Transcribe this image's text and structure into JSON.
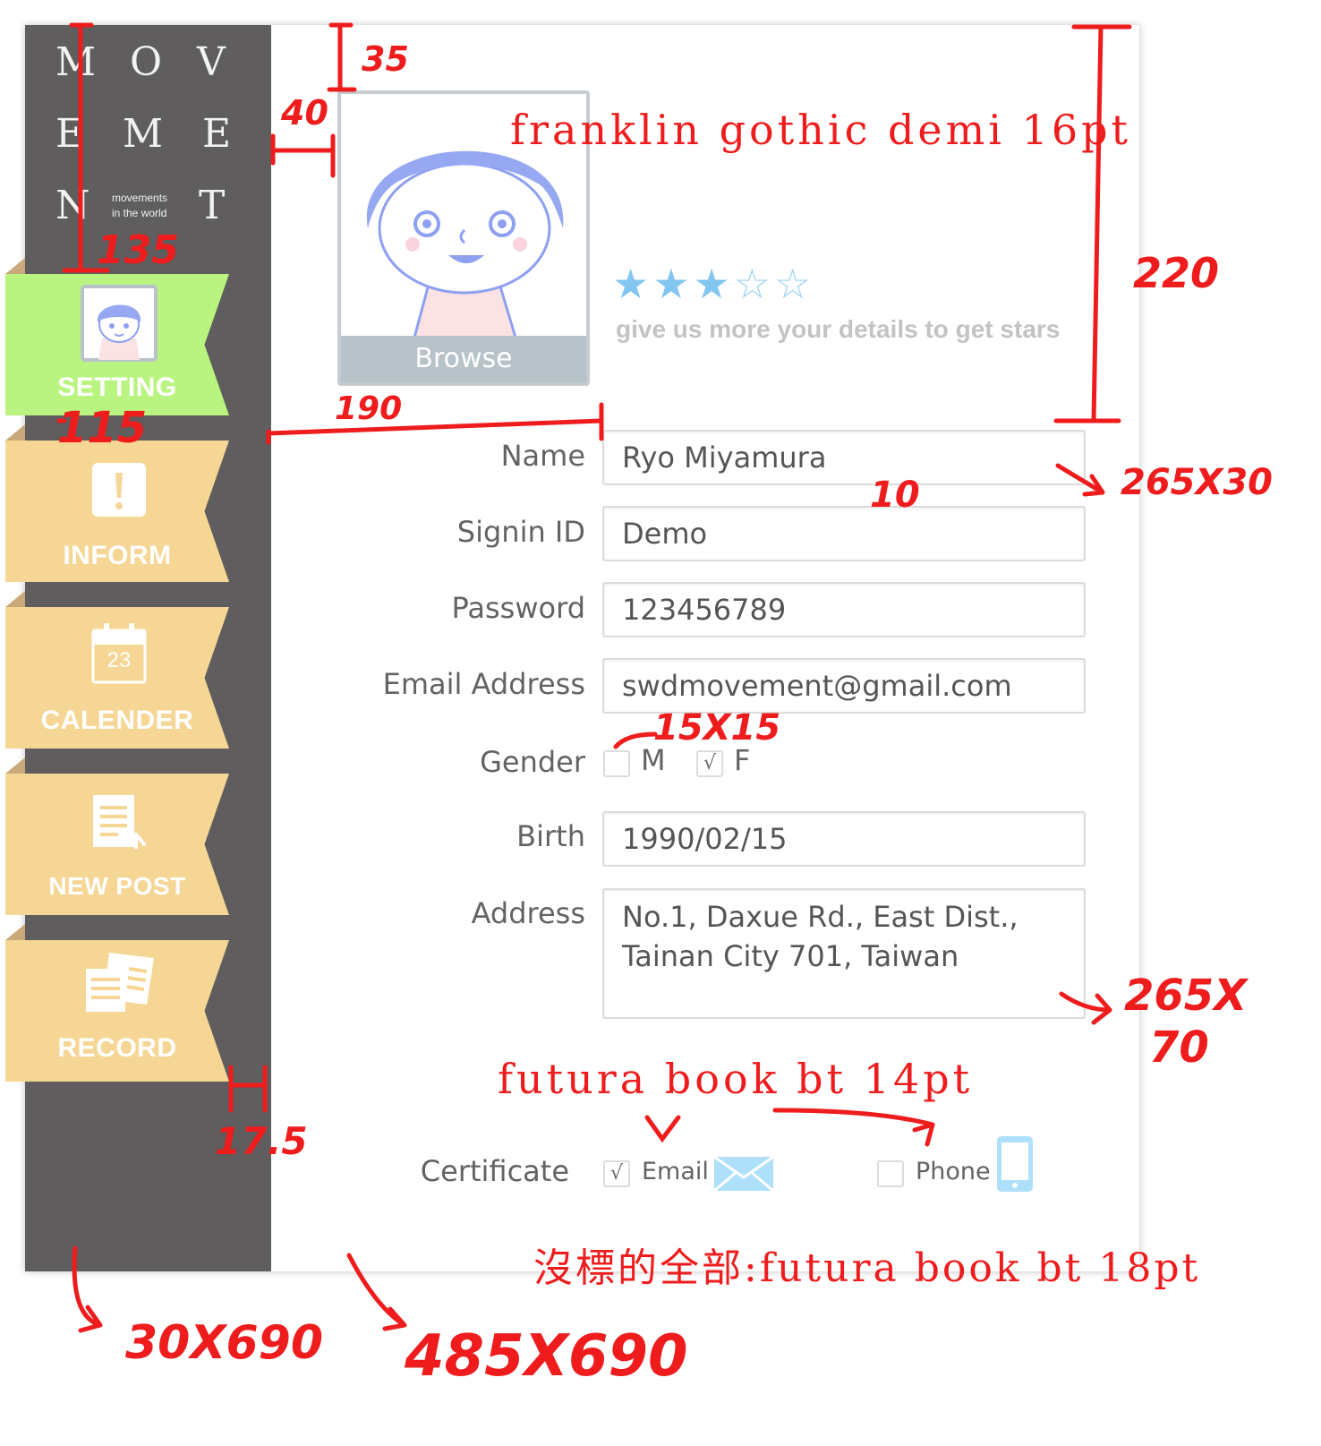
{
  "logo": {
    "letters": [
      "M",
      "O",
      "V",
      "E",
      "M",
      "E",
      "N",
      "T"
    ],
    "tagline_line1": "movements",
    "tagline_line2": "in the world"
  },
  "nav": [
    {
      "label": "SETTING",
      "icon": "avatar-thumbnail-icon",
      "active": true
    },
    {
      "label": "INFORM",
      "icon": "exclamation-icon",
      "active": false
    },
    {
      "label": "CALENDER",
      "icon": "calendar-icon",
      "active": false,
      "icon_text": "23"
    },
    {
      "label": "NEW POST",
      "icon": "document-upload-icon",
      "active": false
    },
    {
      "label": "RECORD",
      "icon": "documents-stack-icon",
      "active": false
    }
  ],
  "profile": {
    "browse_label": "Browse",
    "rating": {
      "value": 3,
      "max": 5
    },
    "stars_hint": "give us more your details to get stars"
  },
  "form": {
    "name": {
      "label": "Name",
      "value": "Ryo Miyamura"
    },
    "signin": {
      "label": "Signin ID",
      "value": "Demo"
    },
    "password": {
      "label": "Password",
      "value": "123456789"
    },
    "email": {
      "label": "Email Address",
      "value": "swdmovement@gmail.com"
    },
    "gender": {
      "label": "Gender",
      "options": [
        {
          "label": "M",
          "checked": false
        },
        {
          "label": "F",
          "checked": true
        }
      ]
    },
    "birth": {
      "label": "Birth",
      "value": "1990/02/15"
    },
    "address": {
      "label": "Address",
      "line1": "No.1, Daxue Rd., East Dist.,",
      "line2": "Tainan City 701, Taiwan"
    },
    "certificate": {
      "label": "Certificate",
      "options": [
        {
          "label": "Email",
          "checked": true,
          "icon": "envelope-icon"
        },
        {
          "label": "Phone",
          "checked": false,
          "icon": "phone-icon"
        }
      ]
    }
  },
  "check_mark": "√",
  "annotations": {
    "m35": "35",
    "m40": "40",
    "font_title": "franklin gothic demi 16pt",
    "m220": "220",
    "m135": "135",
    "m115": "115",
    "m190": "190",
    "m10": "10",
    "m265x30": "265X30",
    "m15x15": "15X15",
    "m265x": "265X",
    "m70": "70",
    "font_small": "futura book bt 14pt",
    "m17_5": "17.5",
    "font_default": "沒標的全部:futura book bt 18pt",
    "m30x690": "30X690",
    "m485x690": "485X690"
  },
  "colors": {
    "sidebar": "#5f5d5d",
    "nav_active": "#b9f481",
    "nav_inactive": "#f6d694",
    "star": "#83c7f0",
    "annotation": "#ee1c1c"
  }
}
